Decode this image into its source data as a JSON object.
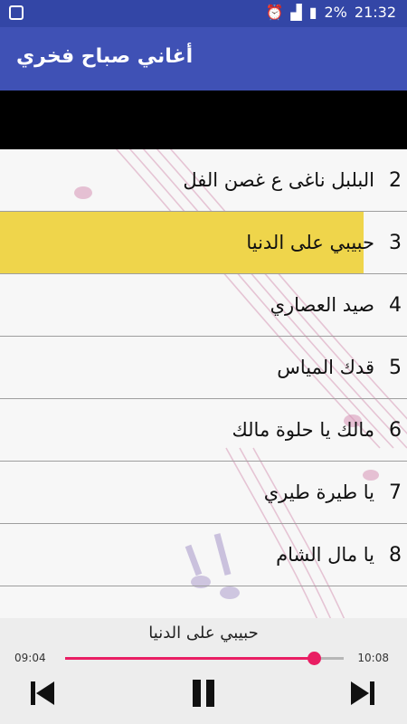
{
  "status_bar": {
    "battery_percent": "2%",
    "time": "21:32",
    "icons": [
      "app-notification-icon",
      "alarm-icon",
      "signal-icon",
      "battery-charging-icon"
    ]
  },
  "app_bar": {
    "title": "أغاني صباح فخري"
  },
  "songs": [
    {
      "number": "2",
      "title": "البلبل ناغى ع غصن الفل",
      "active": false
    },
    {
      "number": "3",
      "title": "حبيبي على الدنيا",
      "active": true
    },
    {
      "number": "4",
      "title": "صيد العصاري",
      "active": false
    },
    {
      "number": "5",
      "title": "قدك المياس",
      "active": false
    },
    {
      "number": "6",
      "title": "مالك يا حلوة مالك",
      "active": false
    },
    {
      "number": "7",
      "title": "يا طيرة طيري",
      "active": false
    },
    {
      "number": "8",
      "title": "يا مال الشام",
      "active": false
    }
  ],
  "player": {
    "now_playing": "حبيبي على الدنيا",
    "elapsed": "09:04",
    "duration": "10:08",
    "progress": 0.894,
    "controls": [
      "skip-previous-icon",
      "pause-icon",
      "skip-next-icon"
    ],
    "accent_color": "#e91e63"
  },
  "colors": {
    "status_bar": "#3346a6",
    "app_bar": "#3f51b5",
    "active_row": "#efd54b"
  }
}
